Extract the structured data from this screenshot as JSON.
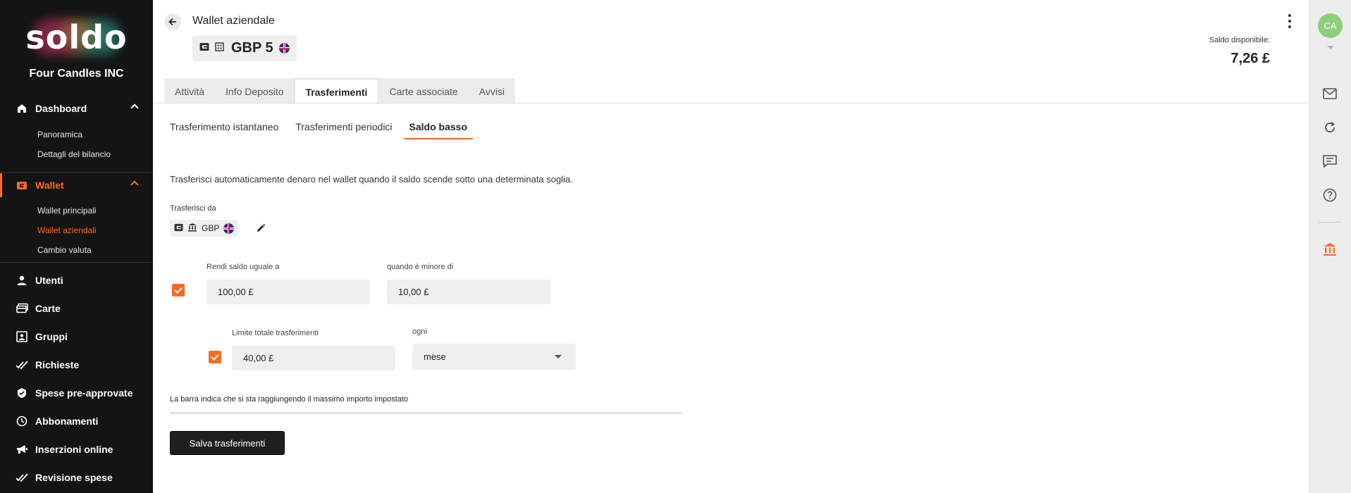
{
  "sidebar": {
    "logo": "soldo",
    "company": "Four Candles INC",
    "sections": [
      {
        "label": "Dashboard",
        "icon": "home-icon"
      },
      {
        "label": "Wallet",
        "icon": "wallet-icon"
      },
      {
        "label": "Utenti",
        "icon": "user-icon"
      },
      {
        "label": "Carte",
        "icon": "card-icon"
      },
      {
        "label": "Gruppi",
        "icon": "group-icon"
      },
      {
        "label": "Richieste",
        "icon": "check-icon"
      },
      {
        "label": "Spese pre-approvate",
        "icon": "shield-icon"
      },
      {
        "label": "Abbonamenti",
        "icon": "clock-icon"
      },
      {
        "label": "Inserzioni online",
        "icon": "megaphone-icon"
      },
      {
        "label": "Revisione spese",
        "icon": "review-icon"
      }
    ],
    "dashboard_sub": [
      "Panoramica",
      "Dettagli del bilancio"
    ],
    "wallet_sub": [
      "Wallet principali",
      "Wallet aziendali",
      "Cambio valuta"
    ]
  },
  "header": {
    "title": "Wallet aziendale",
    "wallet_name": "GBP 5",
    "balance_label": "Saldo disponibile:",
    "balance_value": "7,26 £"
  },
  "tabs": [
    "Attività",
    "Info Deposito",
    "Trasferimenti",
    "Carte associate",
    "Avvisi"
  ],
  "subtabs": [
    "Trasferimento istantaneo",
    "Trasferimenti periodici",
    "Saldo basso"
  ],
  "form": {
    "description": "Trasferisci automaticamente denaro nel wallet quando il saldo scende sotto una determinata soglia.",
    "from_label": "Trasferisci da",
    "from_currency": "GBP",
    "balance_equal_label": "Rendi saldo uguale a",
    "balance_equal_value": "100,00 £",
    "when_less_label": "quando è minore di",
    "when_less_value": "10,00 £",
    "total_limit_label": "Limite totale trasferimenti",
    "total_limit_value": "40,00 £",
    "every_label": "ogni",
    "every_value": "mese",
    "bar_label": "La barra indica che si sta raggiungendo il massimo importo impostato",
    "bar_progress": 0,
    "save_label": "Salva trasferimenti"
  },
  "user": {
    "initials": "CA"
  },
  "colors": {
    "accent": "#ff6a1f",
    "sidebar_bg": "#141414",
    "avatar": "#8cd07a"
  }
}
